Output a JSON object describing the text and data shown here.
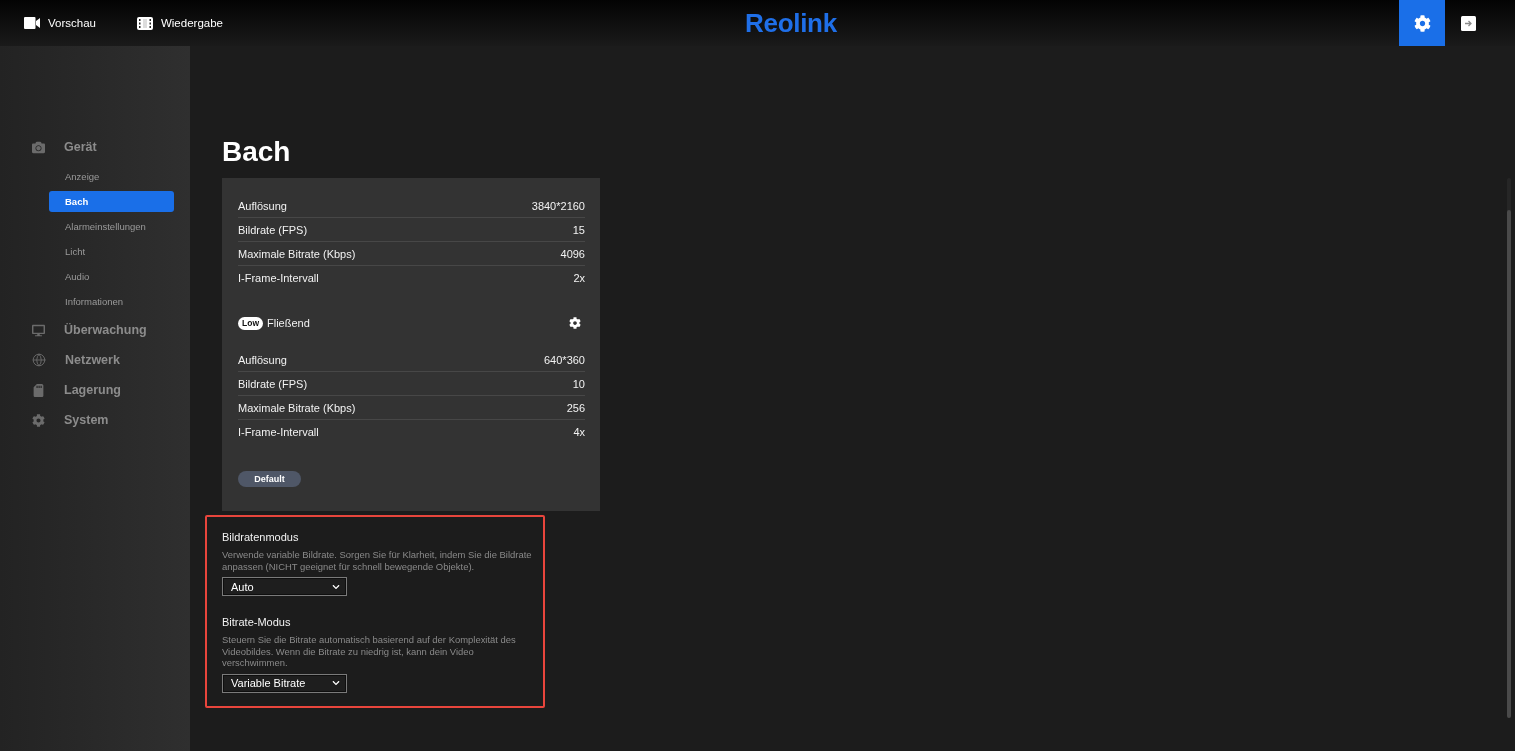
{
  "top_bar": {
    "nav": [
      {
        "label": "Vorschau",
        "kind": "camera"
      },
      {
        "label": "Wiedergabe",
        "kind": "film"
      }
    ],
    "logo": "Reolink",
    "actions": [
      {
        "kind": "settings",
        "selected": true
      },
      {
        "kind": "logout",
        "selected": false
      }
    ]
  },
  "sidebar": {
    "sections": [
      {
        "label": "Gerät",
        "kind": "camera",
        "children": [
          {
            "label": "Anzeige",
            "selected": false
          },
          {
            "label": "Bach",
            "selected": true
          },
          {
            "label": "Alarmeinstellungen",
            "selected": false
          },
          {
            "label": "Licht",
            "selected": false
          },
          {
            "label": "Audio",
            "selected": false
          },
          {
            "label": "Informationen",
            "selected": false
          }
        ]
      },
      {
        "label": "Überwachung",
        "kind": "monitor"
      },
      {
        "label": "Netzwerk",
        "kind": "globe"
      },
      {
        "label": "Lagerung",
        "kind": "storage"
      },
      {
        "label": "System",
        "kind": "gear"
      }
    ]
  },
  "page": {
    "title": "Bach",
    "streams": [
      {
        "rows": [
          {
            "label": "Auflösung",
            "value": "3840*2160"
          },
          {
            "label": "Bildrate (FPS)",
            "value": "15"
          },
          {
            "label": "Maximale Bitrate (Kbps)",
            "value": "4096"
          },
          {
            "label": "I-Frame-Intervall",
            "value": "2x"
          }
        ]
      },
      {
        "badge": "Low",
        "name": "Fließend",
        "rows": [
          {
            "label": "Auflösung",
            "value": "640*360"
          },
          {
            "label": "Bildrate (FPS)",
            "value": "10"
          },
          {
            "label": "Maximale Bitrate (Kbps)",
            "value": "256"
          },
          {
            "label": "I-Frame-Intervall",
            "value": "4x"
          }
        ]
      }
    ],
    "default_button": "Default"
  },
  "settings": {
    "highlighted": true,
    "items": [
      {
        "title": "Bildratenmodus",
        "description": "Verwende variable Bildrate. Sorgen Sie für Klarheit, indem Sie die Bildrate anpassen (NICHT geeignet für schnell bewegende Objekte).",
        "value": "Auto"
      },
      {
        "title": "Bitrate-Modus",
        "description": "Steuern Sie die Bitrate automatisch basierend auf der Komplexität des Videobildes. Wenn die Bitrate zu niedrig ist, kann dein Video verschwimmen.",
        "value": "Variable Bitrate"
      }
    ]
  }
}
